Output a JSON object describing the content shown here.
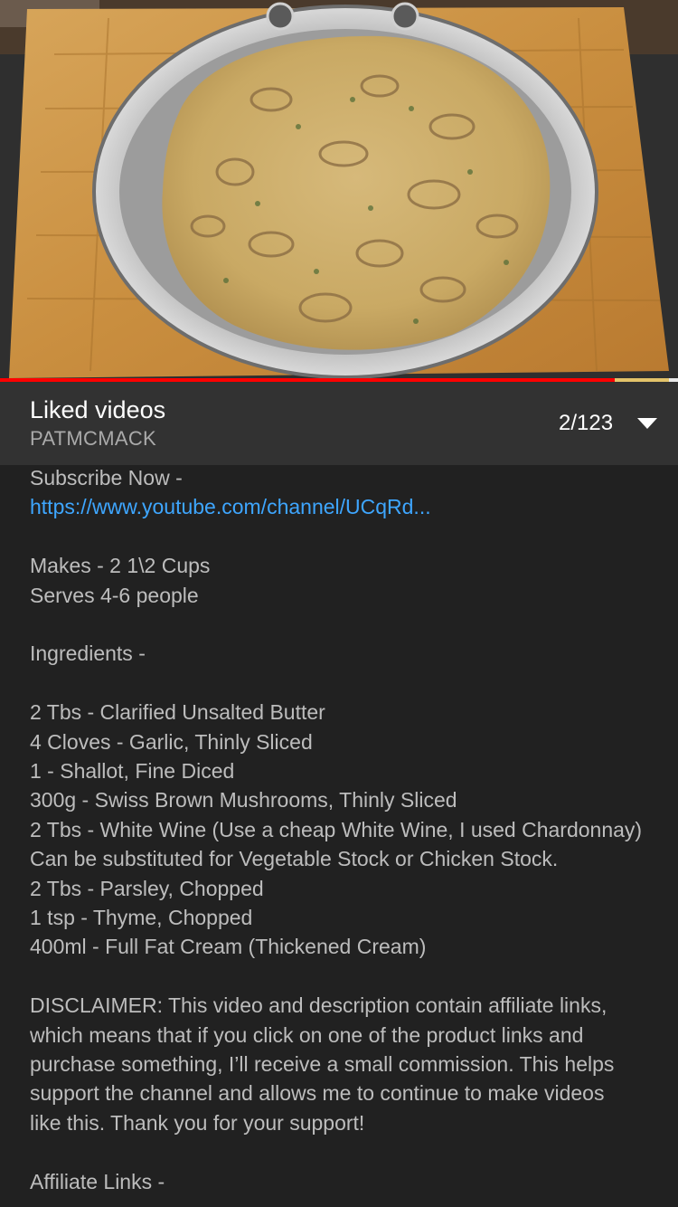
{
  "playlist": {
    "title": "Liked videos",
    "owner": "PATMCMACK",
    "position": "2/123"
  },
  "player": {
    "progress_played": 0.907,
    "progress_buffered": 0.987,
    "played_color": "#ff0000",
    "buffered_color": "#e3c36a"
  },
  "description": {
    "subscribe": "Subscribe Now -",
    "subscribe_link": "https://www.youtube.com/channel/UCqRd...",
    "makes": "Makes - 2 1\\2 Cups",
    "serves": "Serves 4-6 people",
    "ingredients_heading": "Ingredients -",
    "ingredients": [
      "2 Tbs - Clarified Unsalted Butter",
      "4 Cloves - Garlic, Thinly Sliced",
      "1 - Shallot, Fine Diced",
      "300g - Swiss Brown Mushrooms, Thinly Sliced",
      "2 Tbs - White Wine (Use a cheap White Wine, I used Chardonnay)",
      "Can be substituted for Vegetable Stock or Chicken Stock.",
      "2 Tbs - Parsley, Chopped",
      "1 tsp - Thyme, Chopped",
      "400ml - Full Fat Cream (Thickened Cream)"
    ],
    "disclaimer_lines": [
      "DISCLAIMER: This video and description contain affiliate links,",
      "which means that if you click on one of the product links and",
      "purchase something, I’ll receive a small commission. This helps",
      "support the channel and allows me to continue to make videos",
      "like this. Thank you for your support!"
    ],
    "affiliate_heading": "Affiliate Links -"
  },
  "icons": {
    "expand": "chevron-down-icon"
  },
  "colors": {
    "background": "#212121",
    "header_background": "#323232",
    "link": "#3ea6ff",
    "text_secondary": "#bdbdbd"
  }
}
